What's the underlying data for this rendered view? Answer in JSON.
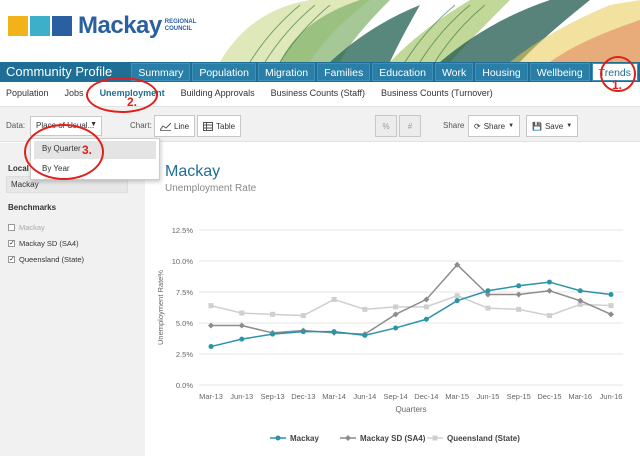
{
  "header": {
    "logo_text": "Mackay",
    "logo_sub_1": "REGIONAL",
    "logo_sub_2": "COUNCIL"
  },
  "nav": {
    "title": "Community Profile",
    "tabs": [
      "Summary",
      "Population",
      "Migration",
      "Families",
      "Education",
      "Work",
      "Housing",
      "Wellbeing",
      "Trends"
    ],
    "active_tab": "Trends"
  },
  "subnav": {
    "items": [
      "Population",
      "Jobs",
      "Unemployment",
      "Building Approvals",
      "Business Counts (Staff)",
      "Business Counts (Turnover)"
    ],
    "active": "Unemployment"
  },
  "toolbar": {
    "data_label": "Data:",
    "data_value": "Place of Usual...",
    "chart_label": "Chart:",
    "line_label": "Line",
    "table_label": "Table",
    "percent_label": "%",
    "hash_label": "#",
    "share_label": "Share",
    "share_button": "Share",
    "save_button": "Save"
  },
  "dropdown": {
    "options": [
      "By Quarter",
      "By Year"
    ],
    "highlighted": "By Quarter"
  },
  "sidebar": {
    "local_label": "Local C",
    "local_value": "Mackay",
    "benchmarks_label": "Benchmarks",
    "benchmarks": [
      {
        "label": "Mackay",
        "checked": false,
        "disabled": true
      },
      {
        "label": "Mackay SD (SA4)",
        "checked": true,
        "disabled": false
      },
      {
        "label": "Queensland (State)",
        "checked": true,
        "disabled": false
      }
    ]
  },
  "annotations": [
    "1.",
    "2.",
    "3."
  ],
  "colors": {
    "accent": "#1e6e96",
    "mackay": "#2a94a8",
    "mackay_sd": "#8c8c8c",
    "queensland": "#cfcfcf",
    "annotation": "#e0201a"
  },
  "chart_data": {
    "type": "line",
    "title": "Mackay",
    "subtitle": "Unemployment Rate",
    "xlabel": "Quarters",
    "ylabel": "Unemployment Rate%",
    "ylim": [
      0,
      12.5
    ],
    "yticks": [
      "0.0%",
      "2.5%",
      "5.0%",
      "7.5%",
      "10.0%",
      "12.5%"
    ],
    "categories": [
      "Mar-13",
      "Jun-13",
      "Sep-13",
      "Dec-13",
      "Mar-14",
      "Jun-14",
      "Sep-14",
      "Dec-14",
      "Mar-15",
      "Jun-15",
      "Sep-15",
      "Dec-15",
      "Mar-16",
      "Jun-16"
    ],
    "series": [
      {
        "name": "Mackay",
        "values": [
          3.1,
          3.7,
          4.1,
          4.3,
          4.3,
          4.0,
          4.6,
          5.3,
          6.8,
          7.6,
          8.0,
          8.3,
          7.6,
          7.3
        ]
      },
      {
        "name": "Mackay SD (SA4)",
        "values": [
          4.8,
          4.8,
          4.2,
          4.4,
          4.2,
          4.1,
          5.7,
          6.9,
          9.7,
          7.3,
          7.3,
          7.6,
          6.8,
          5.7
        ]
      },
      {
        "name": "Queensland (State)",
        "values": [
          6.4,
          5.8,
          5.7,
          5.6,
          6.9,
          6.1,
          6.3,
          6.3,
          7.2,
          6.2,
          6.1,
          5.6,
          6.5,
          6.4
        ]
      }
    ],
    "legend_position": "bottom",
    "grid": true
  }
}
